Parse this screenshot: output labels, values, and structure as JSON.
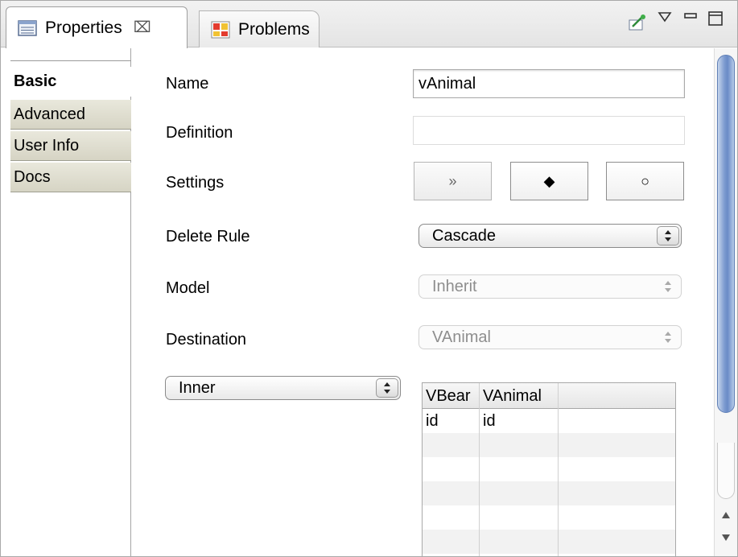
{
  "tabs": {
    "properties_label": "Properties",
    "close_symbol": "⌧",
    "problems_label": "Problems"
  },
  "side_tabs": [
    {
      "label": "Basic",
      "active": true
    },
    {
      "label": "Advanced",
      "active": false
    },
    {
      "label": "User Info",
      "active": false
    },
    {
      "label": "Docs",
      "active": false
    }
  ],
  "form": {
    "name_label": "Name",
    "name_value": "vAnimal",
    "definition_label": "Definition",
    "definition_value": "",
    "settings_label": "Settings",
    "settings_buttons": [
      "»",
      "◆",
      "○"
    ],
    "delete_rule_label": "Delete Rule",
    "delete_rule_value": "Cascade",
    "model_label": "Model",
    "model_value": "Inherit",
    "destination_label": "Destination",
    "destination_value": "VAnimal",
    "join_select_value": "Inner"
  },
  "join_table": {
    "columns": [
      "VBear",
      "VAnimal"
    ],
    "rows": [
      [
        "id",
        "id"
      ]
    ]
  },
  "colors": {
    "side_tab_bg": "#dcdac9",
    "scroll_thumb": "#7d9bd0",
    "border": "#a9a9a9"
  }
}
